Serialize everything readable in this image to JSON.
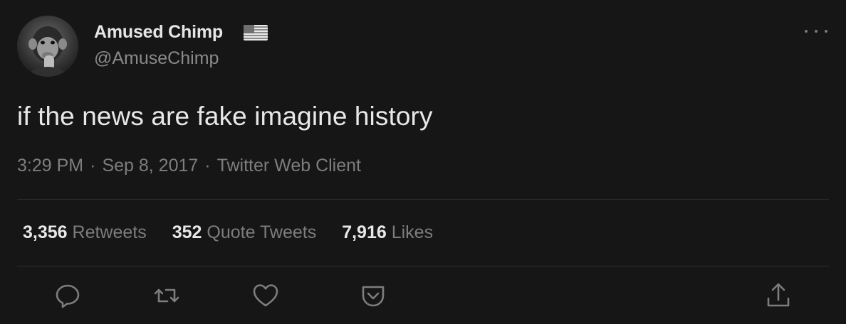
{
  "author": {
    "name": "Amused Chimp",
    "handle": "@AmuseChimp"
  },
  "tweet": {
    "text": "if the news are fake imagine history",
    "time": "3:29 PM",
    "separator": "·",
    "date": "Sep 8, 2017",
    "client": "Twitter Web Client"
  },
  "stats": {
    "retweets_count": "3,356",
    "retweets_label": "Retweets",
    "quote_count": "352",
    "quote_label": "Quote Tweets",
    "likes_count": "7,916",
    "likes_label": "Likes"
  },
  "icons": {
    "verified_flag": "us-flag-icon",
    "more": "more-options-icon",
    "reply": "reply-icon",
    "retweet": "retweet-icon",
    "like": "heart-icon",
    "bookmark": "bookmark-icon",
    "share": "share-icon"
  },
  "colors": {
    "background": "#161616",
    "primary_text": "#e8e8e8",
    "secondary_text": "#7d7d7d",
    "divider": "#2f2f2f"
  }
}
